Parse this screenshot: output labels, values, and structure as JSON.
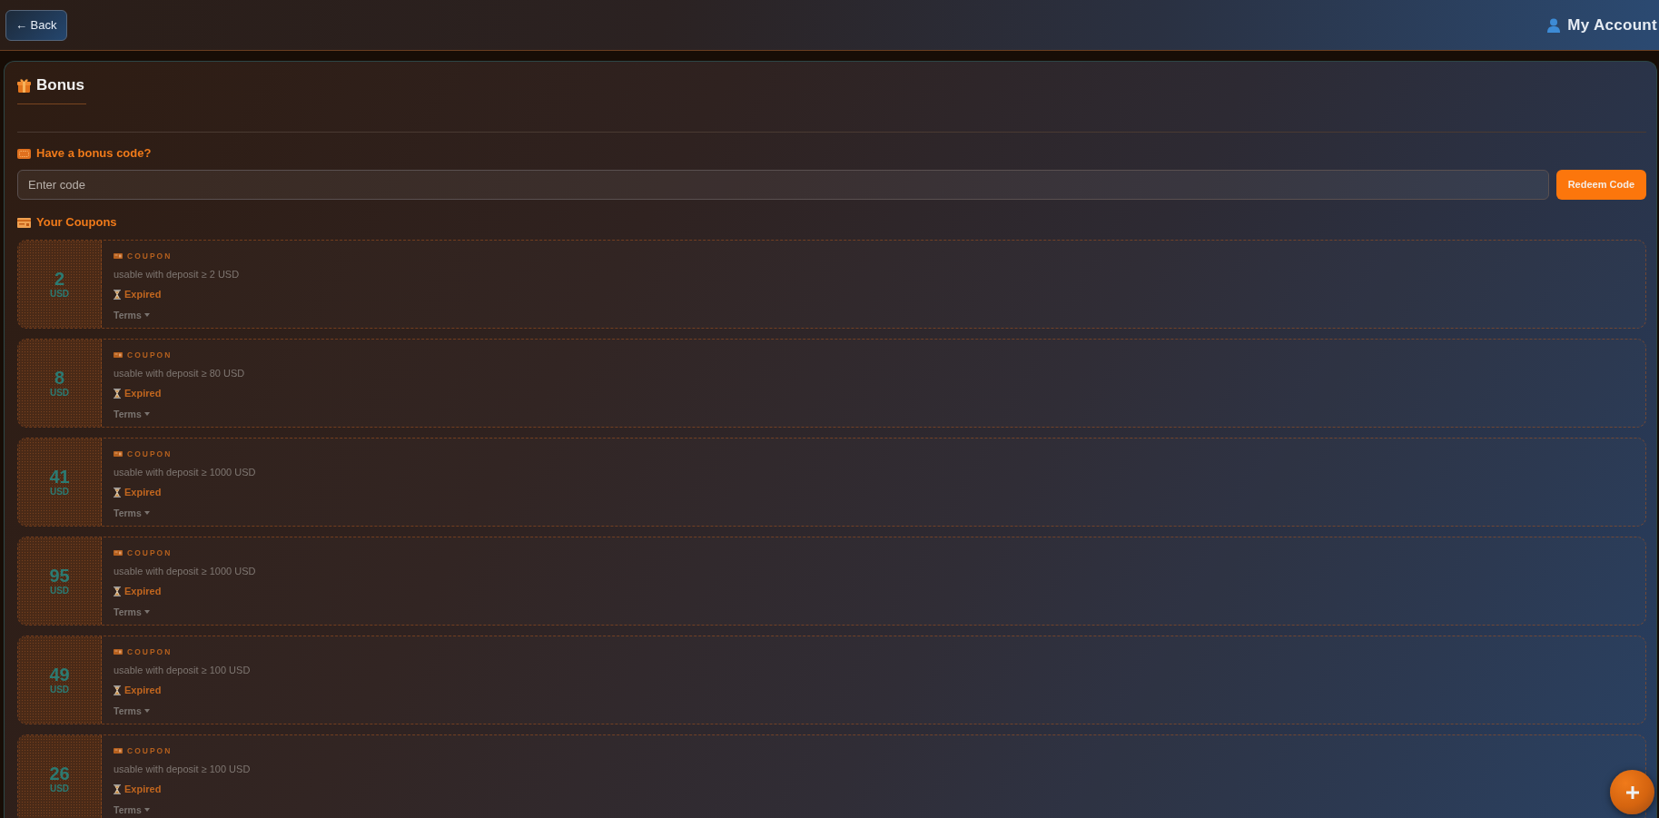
{
  "top_bar": {
    "back_button": "← Back",
    "account_link": "My Account"
  },
  "panel": {
    "title": "Bonus",
    "code_form": {
      "heading": "Have a bonus code?",
      "input": {
        "placeholder": "Enter code"
      },
      "submit_button": "Redeem Code"
    },
    "coupons_heading": "Your Coupons",
    "coupons": [
      {
        "amount": "2",
        "currency": "USD",
        "type": "COUPON",
        "condition": "usable with deposit ≥ 2 USD",
        "status": "Expired",
        "expired": true,
        "terms": {
          "label": "Terms",
          "expanded": false
        }
      },
      {
        "amount": "8",
        "currency": "USD",
        "type": "COUPON",
        "condition": "usable with deposit ≥ 80 USD",
        "status": "Expired",
        "expired": true,
        "terms": {
          "label": "Terms",
          "expanded": false
        }
      },
      {
        "amount": "41",
        "currency": "USD",
        "type": "COUPON",
        "condition": "usable with deposit ≥ 1000 USD",
        "status": "Expired",
        "expired": true,
        "terms": {
          "label": "Terms",
          "expanded": false
        }
      },
      {
        "amount": "95",
        "currency": "USD",
        "type": "COUPON",
        "condition": "usable with deposit ≥ 1000 USD",
        "status": "Expired",
        "expired": true,
        "terms": {
          "label": "Terms",
          "expanded": false
        }
      },
      {
        "amount": "49",
        "currency": "USD",
        "type": "COUPON",
        "condition": "usable with deposit ≥ 100 USD",
        "status": "Expired",
        "expired": true,
        "terms": {
          "label": "Terms",
          "expanded": false
        }
      },
      {
        "amount": "26",
        "currency": "USD",
        "type": "COUPON",
        "condition": "usable with deposit ≥ 100 USD",
        "status": "Expired",
        "expired": true,
        "terms": {
          "label": "Terms",
          "expanded": false
        }
      }
    ]
  }
}
